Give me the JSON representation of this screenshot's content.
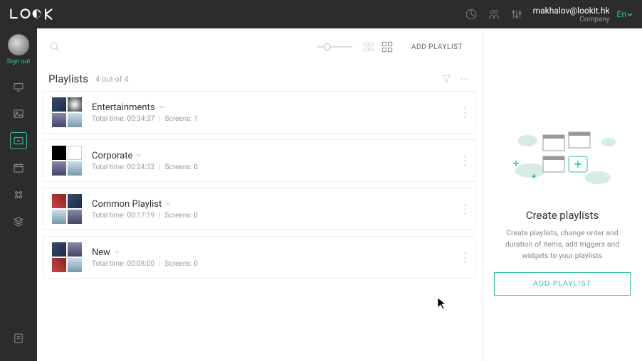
{
  "header": {
    "user_email": "makhalov@lookit.hk",
    "company_label": "Company",
    "language": "En",
    "signout": "Sign out"
  },
  "toolbar": {
    "add_playlist": "ADD PLAYLIST"
  },
  "subhead": {
    "title": "Playlists",
    "count": "4 out of 4"
  },
  "playlists": [
    {
      "name": "Entertainments",
      "total_time": "00:34:37",
      "screens": 1
    },
    {
      "name": "Corporate",
      "total_time": "00:24:32",
      "screens": 0
    },
    {
      "name": "Common Playlist",
      "total_time": "00:17:19",
      "screens": 0
    },
    {
      "name": "New",
      "total_time": "00:08:00",
      "screens": 0
    }
  ],
  "labels": {
    "total_time_prefix": "Total time: ",
    "screens_prefix": "Screens: "
  },
  "rightpanel": {
    "title": "Create playlists",
    "desc": "Create playlists, change order and duration of items, add triggers and widgets to your playlists",
    "button": "ADD PLAYLIST"
  },
  "colors": {
    "accent": "#2fc29f"
  }
}
